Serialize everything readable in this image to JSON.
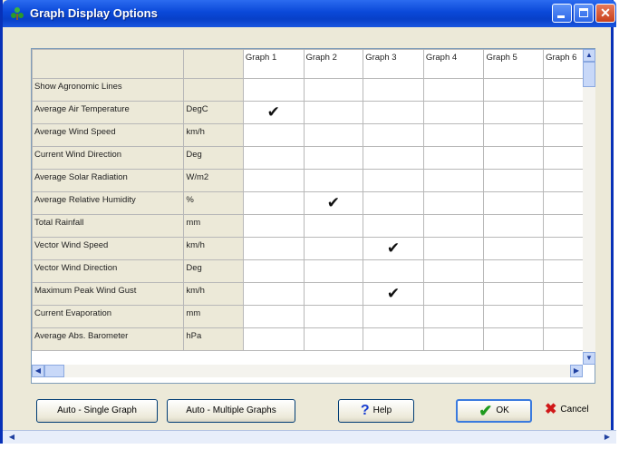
{
  "window": {
    "title": "Graph Display Options"
  },
  "grid": {
    "columns": [
      "Graph 1",
      "Graph 2",
      "Graph 3",
      "Graph 4",
      "Graph 5",
      "Graph 6"
    ],
    "rows": [
      {
        "label": "Show Agronomic Lines",
        "unit": "",
        "checks": [
          false,
          false,
          false,
          false,
          false,
          false
        ]
      },
      {
        "label": "Average Air Temperature",
        "unit": "DegC",
        "checks": [
          true,
          false,
          false,
          false,
          false,
          false
        ]
      },
      {
        "label": "Average Wind Speed",
        "unit": "km/h",
        "checks": [
          false,
          false,
          false,
          false,
          false,
          false
        ]
      },
      {
        "label": "Current Wind Direction",
        "unit": "Deg",
        "checks": [
          false,
          false,
          false,
          false,
          false,
          false
        ]
      },
      {
        "label": "Average Solar Radiation",
        "unit": "W/m2",
        "checks": [
          false,
          false,
          false,
          false,
          false,
          false
        ]
      },
      {
        "label": "Average Relative Humidity",
        "unit": "%",
        "checks": [
          false,
          true,
          false,
          false,
          false,
          false
        ]
      },
      {
        "label": "Total Rainfall",
        "unit": "mm",
        "checks": [
          false,
          false,
          false,
          false,
          false,
          false
        ]
      },
      {
        "label": "Vector Wind Speed",
        "unit": "km/h",
        "checks": [
          false,
          false,
          true,
          false,
          false,
          false
        ]
      },
      {
        "label": "Vector Wind Direction",
        "unit": "Deg",
        "checks": [
          false,
          false,
          false,
          false,
          false,
          false
        ]
      },
      {
        "label": "Maximum Peak Wind Gust",
        "unit": "km/h",
        "checks": [
          false,
          false,
          true,
          false,
          false,
          false
        ]
      },
      {
        "label": "Current Evaporation",
        "unit": "mm",
        "checks": [
          false,
          false,
          false,
          false,
          false,
          false
        ]
      },
      {
        "label": "Average Abs. Barometer",
        "unit": "hPa",
        "checks": [
          false,
          false,
          false,
          false,
          false,
          false
        ]
      }
    ]
  },
  "buttons": {
    "auto_single": "Auto - Single Graph",
    "auto_multiple": "Auto - Multiple Graphs",
    "help": "Help",
    "ok": "OK",
    "cancel": "Cancel"
  },
  "colors": {
    "titlebar": "#0a48d8",
    "ok_icon": "#1e9a1e",
    "cancel_icon": "#d01818",
    "help_icon": "#1a3fd0"
  }
}
